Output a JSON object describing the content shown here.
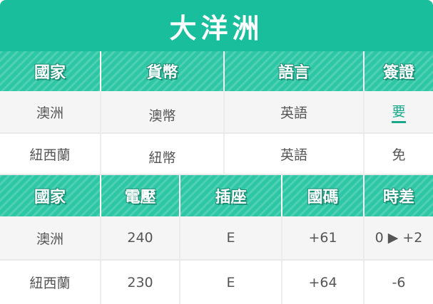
{
  "title": "大洋洲",
  "section1": {
    "headers": [
      "國家",
      "貨幣",
      "語言",
      "簽證"
    ],
    "rows": [
      [
        "澳洲",
        "澳幣",
        "英語",
        "要"
      ],
      [
        "紐西蘭",
        "紐幣",
        "英語",
        "免"
      ]
    ]
  },
  "section2": {
    "headers": [
      "國家",
      "電壓",
      "插座",
      "國碼",
      "時差"
    ],
    "rows": [
      [
        "澳洲",
        "240",
        "E",
        "+61",
        "0 ▶ +2"
      ],
      [
        "紐西蘭",
        "230",
        "E",
        "+64",
        "-6"
      ]
    ]
  },
  "colors": {
    "brand": "#19be9c",
    "header": "#2dc7a6",
    "accent": "#19a88a"
  }
}
